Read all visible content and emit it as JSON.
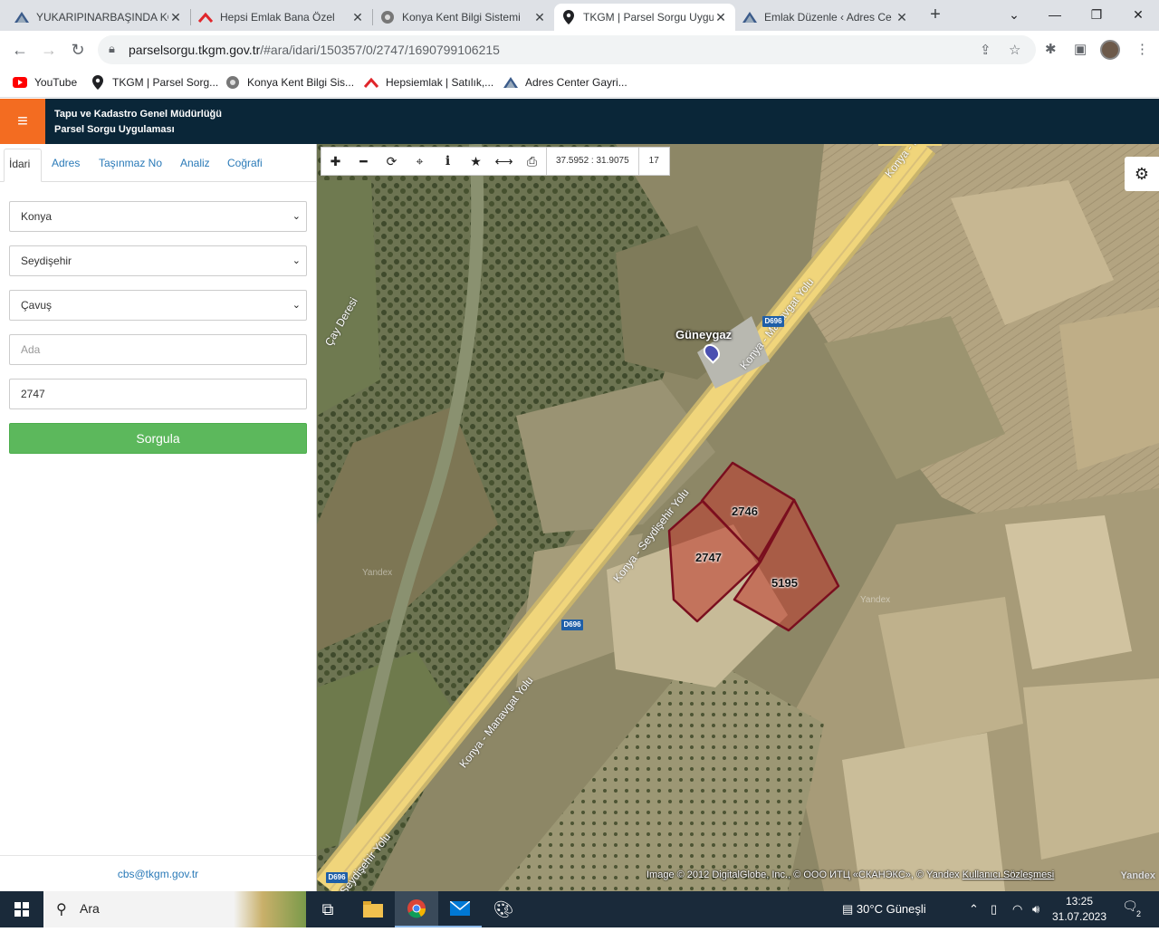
{
  "browser": {
    "tabs": [
      {
        "title": "YUKARIPINARBAŞINDA KO",
        "icon": "adres-center-icon",
        "active": false
      },
      {
        "title": "Hepsi Emlak Bana Özel",
        "icon": "hepsiemlak-icon",
        "active": false
      },
      {
        "title": "Konya Kent Bilgi Sistemi",
        "icon": "konya-logo-icon",
        "active": false
      },
      {
        "title": "TKGM | Parsel Sorgu Uygu",
        "icon": "location-pin-icon",
        "active": true
      },
      {
        "title": "Emlak Düzenle ‹ Adres Ce",
        "icon": "adres-center-icon",
        "active": false
      }
    ],
    "url_host": "parselsorgu.tkgm.gov.tr",
    "url_rest": "/#ara/idari/150357/0/2747/1690799106215",
    "bookmarks": [
      {
        "label": "YouTube",
        "icon": "youtube-icon"
      },
      {
        "label": "TKGM | Parsel Sorg...",
        "icon": "location-pin-icon"
      },
      {
        "label": "Konya Kent Bilgi Sis...",
        "icon": "konya-logo-icon"
      },
      {
        "label": "Hepsiemlak | Satılık,...",
        "icon": "hepsiemlak-icon"
      },
      {
        "label": "Adres Center Gayri...",
        "icon": "adres-center-icon"
      }
    ]
  },
  "app": {
    "title_line1": "Tapu ve Kadastro Genel Müdürlüğü",
    "title_line2": "Parsel Sorgu Uygulaması",
    "accent_color": "#f36c21",
    "header_color": "#0a2638"
  },
  "panel": {
    "tabs": [
      "İdari",
      "Adres",
      "Taşınmaz No",
      "Analiz",
      "Coğrafi"
    ],
    "active_tab": "İdari",
    "province": "Konya",
    "district": "Seydişehir",
    "neighborhood": "Çavuş",
    "ada_placeholder": "Ada",
    "parsel_value": "2747",
    "submit_label": "Sorgula",
    "submit_color": "#5cb85c",
    "footer_email": "cbs@tkgm.gov.tr"
  },
  "map": {
    "coordinates": "37.5952 : 31.9075",
    "zoom": "17",
    "parcels": [
      "2746",
      "2747",
      "5195"
    ],
    "parcel_color": "#c0392b",
    "poi": "Güneygaz",
    "road_labels": [
      "Konya - Manavgat Yolu",
      "Konya - Manavgat Yolu",
      "Konya - Seydişehir Yolu",
      "Konya - Manavgat Yolu",
      "Seydişehir Yolu"
    ],
    "road_shield": "D696",
    "river_label": "Çay Deresi",
    "watermark": "Yandex",
    "attribution": "Image © 2012 DigitalGlobe, Inc., © ООО ИТЦ «СКАНЭКС», © Yandex",
    "terms_link": "Kullanıcı Sözleşmesi",
    "logo": "Yandex"
  },
  "taskbar": {
    "search_placeholder": "Ara",
    "weather": "30°C  Güneşli",
    "time": "13:25",
    "date": "31.07.2023",
    "notifications": "2"
  }
}
